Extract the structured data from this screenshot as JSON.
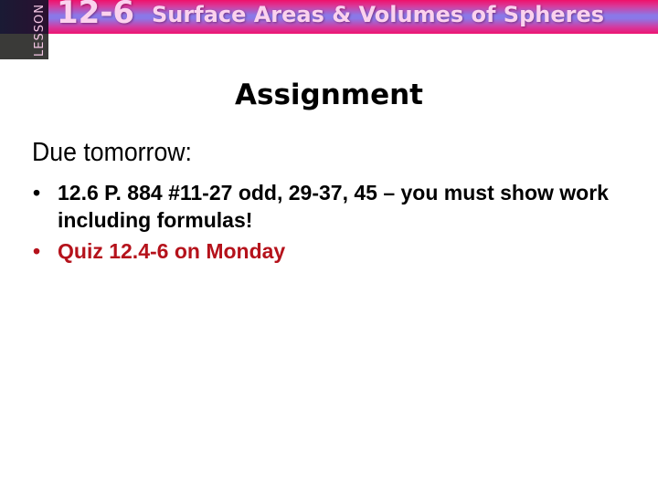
{
  "header": {
    "lesson_label": "LESSON",
    "lesson_number": "12-6",
    "lesson_title": "Surface Areas & Volumes of Spheres"
  },
  "slide": {
    "title": "Assignment",
    "subheading": "Due tomorrow:",
    "bullets": [
      {
        "marker": "•",
        "text": "12.6 P. 884 #11-27 odd, 29-37, 45 – you must show work including formulas!",
        "color": "#000000"
      },
      {
        "marker": "•",
        "text": "Quiz 12.4-6 on Monday",
        "color": "#b5121b"
      }
    ]
  },
  "colors": {
    "header_pink": "#f0106a",
    "header_blue": "#8a78e8",
    "header_text": "#fbd2ee",
    "lesson_block_dark": "#1a1a34",
    "lesson_block_gray": "#3a3a38",
    "quiz_red": "#b5121b"
  }
}
